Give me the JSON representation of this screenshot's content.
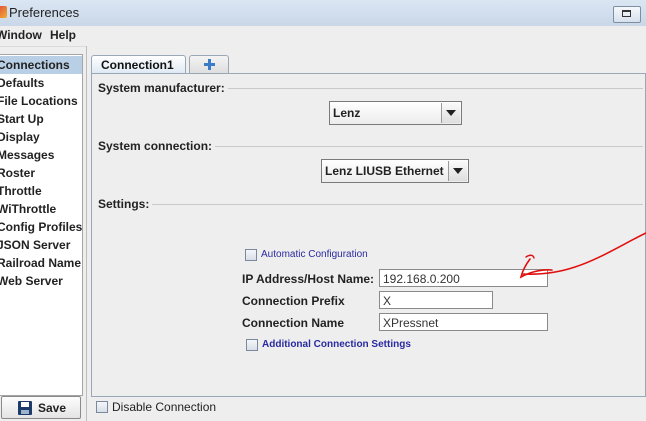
{
  "window": {
    "title": "Preferences"
  },
  "menu": {
    "items": [
      "Window",
      "Help"
    ]
  },
  "sidebar": {
    "items": [
      {
        "label": "Connections",
        "selected": true
      },
      {
        "label": "Defaults"
      },
      {
        "label": "File Locations"
      },
      {
        "label": "Start Up"
      },
      {
        "label": "Display"
      },
      {
        "label": "Messages"
      },
      {
        "label": "Roster"
      },
      {
        "label": "Throttle"
      },
      {
        "label": "WiThrottle"
      },
      {
        "label": "Config Profiles"
      },
      {
        "label": "JSON Server"
      },
      {
        "label": "Railroad Name"
      },
      {
        "label": "Web Server"
      }
    ],
    "save_label": "Save"
  },
  "tabs": {
    "active": "Connection1",
    "add_icon": "plus-icon"
  },
  "manufacturer": {
    "title": "System manufacturer:",
    "value": "Lenz"
  },
  "connection": {
    "title": "System connection:",
    "value": "Lenz LIUSB Ethernet"
  },
  "settings": {
    "title": "Settings:",
    "auto_config_label": "Automatic Configuration",
    "ip_label": "IP Address/Host Name:",
    "ip_value": "192.168.0.200",
    "prefix_label": "Connection Prefix",
    "prefix_value": "X",
    "name_label": "Connection Name",
    "name_value": "XPressnet",
    "additional_label": "Additional Connection Settings"
  },
  "footer": {
    "disable_label": "Disable Connection"
  },
  "colors": {
    "selection": "#b8cfe5",
    "annotation": "#e01010",
    "link": "#2a2aa0"
  }
}
